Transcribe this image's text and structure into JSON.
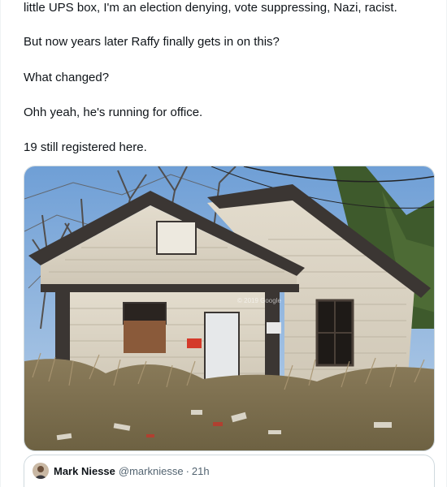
{
  "tweet": {
    "lines": [
      "little UPS box, I'm an election denying, vote suppressing, Nazi, racist.",
      "But now years later Raffy finally gets in on this?",
      "What changed?",
      "Ohh yeah, he's running for office.",
      "19 still registered here."
    ],
    "media": {
      "description_icon": "abandoned-house-photo",
      "watermark": "© 2019 Google"
    }
  },
  "quote_tweet": {
    "display_name": "Mark Niesse",
    "handle": "@markniesse",
    "separator": "·",
    "time": "21h"
  },
  "colors": {
    "text": "#0f1419",
    "secondary_text": "#536471",
    "border": "#cfd9de"
  }
}
